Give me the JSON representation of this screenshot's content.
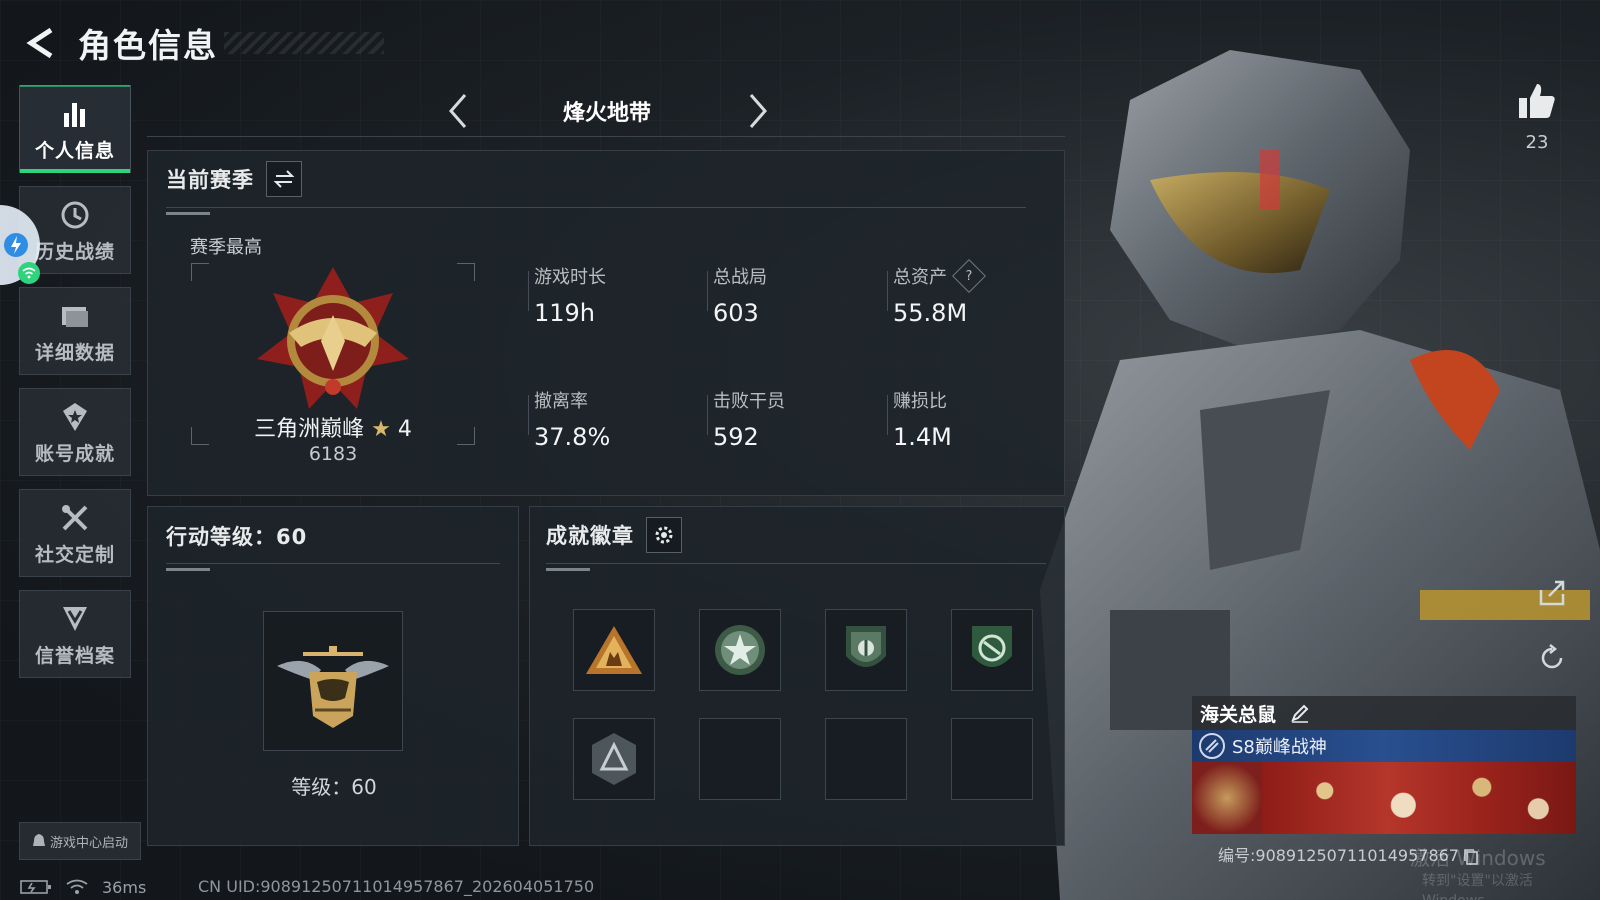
{
  "header": {
    "title": "角色信息"
  },
  "sidebar": {
    "items": [
      {
        "label": "个人信息",
        "icon": "bar-chart-icon",
        "active": true
      },
      {
        "label": "历史战绩",
        "icon": "clock-icon",
        "active": false
      },
      {
        "label": "详细数据",
        "icon": "folder-icon",
        "active": false
      },
      {
        "label": "账号成就",
        "icon": "star-badge-icon",
        "active": false
      },
      {
        "label": "社交定制",
        "icon": "tools-icon",
        "active": false
      },
      {
        "label": "信誉档案",
        "icon": "shield-chevron-icon",
        "active": false
      }
    ],
    "launch_label": "游戏中心启动"
  },
  "mode": {
    "name": "烽火地带"
  },
  "season": {
    "title": "当前赛季",
    "best_label": "赛季最高",
    "rank_name": "三角洲巅峰",
    "rank_star": "★",
    "rank_stars": "4",
    "rank_points": "6183",
    "stats": [
      {
        "label": "游戏时长",
        "value": "119h",
        "help": false
      },
      {
        "label": "总战局",
        "value": "603",
        "help": false
      },
      {
        "label": "总资产",
        "value": "55.8M",
        "help": true
      },
      {
        "label": "撤离率",
        "value": "37.8%",
        "help": false
      },
      {
        "label": "击败干员",
        "value": "592",
        "help": false
      },
      {
        "label": "赚损比",
        "value": "1.4M",
        "help": false
      }
    ],
    "help_glyph": "?"
  },
  "level": {
    "title": "行动等级：60",
    "level_text": "等级：60"
  },
  "achievements": {
    "title": "成就徽章"
  },
  "likes": {
    "count": "23"
  },
  "card": {
    "name": "海关总鼠",
    "title": "S8巅峰战神",
    "id_text": "编号:90891250711014957867"
  },
  "status": {
    "ping": "36ms",
    "uid": "CN UID:90891250711014957867_202604051750"
  },
  "watermark": {
    "main": "激活 Windows",
    "sub": "转到\"设置\"以激活 Windows。"
  },
  "colors": {
    "accent": "#2fd37e",
    "panel": "#1e242a",
    "gold": "#d7b86b"
  }
}
